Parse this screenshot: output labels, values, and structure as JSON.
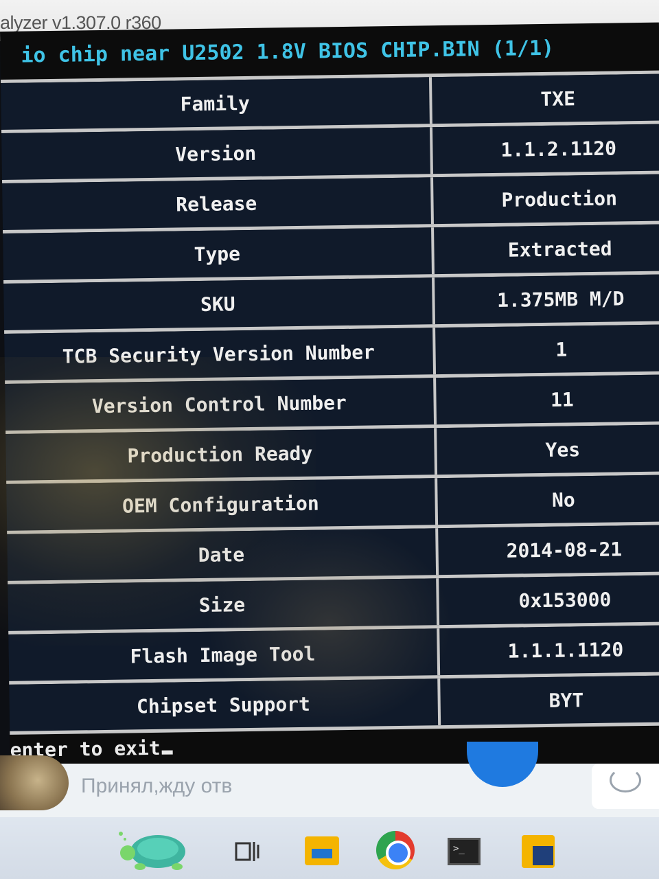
{
  "window": {
    "title": "alyzer v1.307.0 r360"
  },
  "console": {
    "header": "io chip near U2502 1.8V BIOS CHIP.BIN (1/1)",
    "rows": [
      {
        "key": "Family",
        "value": "TXE"
      },
      {
        "key": "Version",
        "value": "1.1.2.1120"
      },
      {
        "key": "Release",
        "value": "Production"
      },
      {
        "key": "Type",
        "value": "Extracted"
      },
      {
        "key": "SKU",
        "value": "1.375MB M/D"
      },
      {
        "key": "TCB Security Version Number",
        "value": "1"
      },
      {
        "key": "Version Control Number",
        "value": "11"
      },
      {
        "key": "Production Ready",
        "value": "Yes"
      },
      {
        "key": "OEM Configuration",
        "value": "No"
      },
      {
        "key": "Date",
        "value": "2014-08-21"
      },
      {
        "key": "Size",
        "value": "0x153000"
      },
      {
        "key": "Flash Image Tool",
        "value": "1.1.1.1120"
      },
      {
        "key": "Chipset Support",
        "value": "BYT"
      }
    ],
    "prompt": "enter to exit"
  },
  "chat": {
    "message_preview": "Принял,жду отв"
  },
  "taskbar": {
    "icons": [
      "turtle-app-icon",
      "task-view-icon",
      "file-explorer-icon",
      "chrome-icon",
      "terminal-icon",
      "powershell-icon"
    ]
  }
}
